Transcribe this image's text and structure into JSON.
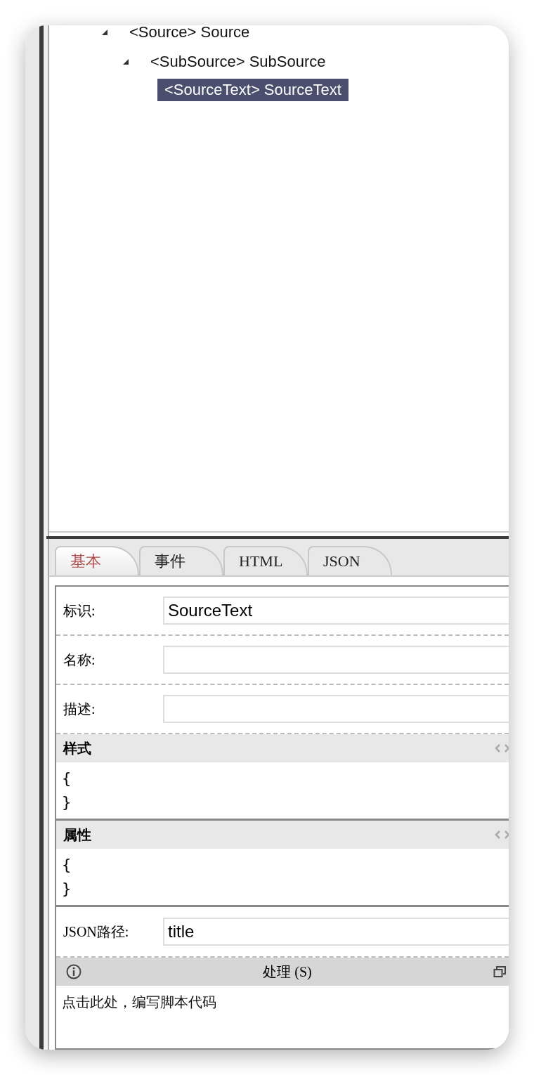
{
  "tree": [
    {
      "label": "<Source> Source",
      "expanded": true,
      "selected": false,
      "children": [
        {
          "label": "<SubSource> SubSource",
          "expanded": true,
          "selected": false,
          "children": [
            {
              "label": "<SourceText> SourceText",
              "selected": true
            }
          ]
        }
      ]
    }
  ],
  "tabs": [
    {
      "label": "基本",
      "selected": true
    },
    {
      "label": "事件",
      "selected": false
    },
    {
      "label": "HTML",
      "selected": false
    },
    {
      "label": "JSON",
      "selected": false
    }
  ],
  "fields": [
    {
      "label": "标识:",
      "value": "SourceText"
    },
    {
      "label": "名称:"
    },
    {
      "label": "描述:"
    }
  ],
  "code_sections": [
    {
      "title": "样式",
      "lines": [
        "{",
        "}"
      ]
    },
    {
      "title": "属性",
      "lines": [
        "{",
        "}"
      ]
    }
  ],
  "path_field": {
    "label": "JSON路径:",
    "value": "title"
  },
  "script": {
    "title": "处理 (S)",
    "placeholder": "点击此处，编写脚本代码"
  }
}
